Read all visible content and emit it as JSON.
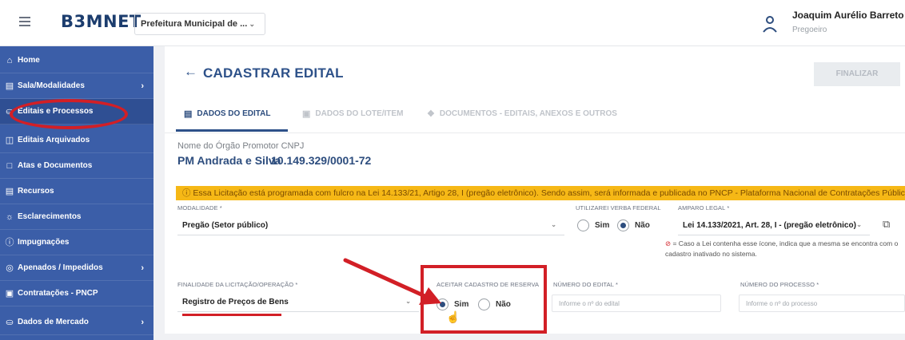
{
  "topbar": {
    "logo": "B3MNET",
    "org_select": "Prefeitura Municipal de ...",
    "user_name": "Joaquim Aurélio Barreto N.",
    "user_role": "Pregoeiro"
  },
  "sidebar": {
    "items": [
      {
        "label": "Home",
        "icon": "home-icon"
      },
      {
        "label": "Sala/Modalidades",
        "icon": "rooms-icon"
      },
      {
        "label": "Editais e Processos",
        "icon": "cart-icon"
      },
      {
        "label": "Editais Arquivados",
        "icon": "archive-icon"
      },
      {
        "label": "Atas e Documentos",
        "icon": "document-icon"
      },
      {
        "label": "Recursos",
        "icon": "resource-icon"
      },
      {
        "label": "Esclarecimentos",
        "icon": "sun-icon"
      },
      {
        "label": "Impugnações",
        "icon": "alert-circle-icon"
      },
      {
        "label": "Apenados / Impedidos",
        "icon": "blocked-icon"
      },
      {
        "label": "Contratações - PNCP",
        "icon": "contract-icon"
      },
      {
        "label": "Dados de Mercado",
        "icon": "cart-icon"
      }
    ]
  },
  "header": {
    "title": "CADASTRAR EDITAL",
    "finalize_label": "FINALIZAR",
    "tabs": [
      {
        "label": "DADOS DO EDITAL"
      },
      {
        "label": "DADOS DO LOTE/ITEM"
      },
      {
        "label": "DOCUMENTOS - EDITAIS, ANEXOS E OUTROS"
      }
    ]
  },
  "orgao": {
    "label": "Nome do Órgão Promotor CNPJ",
    "name": "PM Andrada e Silva",
    "cnpj": "10.149.329/0001-72"
  },
  "alert": {
    "text": "Essa Licitação está programada com fulcro na Lei 14.133/21, Artigo 28, I (pregão eletrônico). Sendo assim, será informada e publicada no PNCP - Plataforma Nacional de Contratações Públicas."
  },
  "form": {
    "modalidade_label": "MODALIDADE *",
    "modalidade_value": "Pregão (Setor público)",
    "verba_label": "UTILIZAREI VERBA FEDERAL",
    "verba_sim": "Sim",
    "verba_nao": "Não",
    "amparo_label": "AMPARO LEGAL *",
    "amparo_value": "Lei 14.133/2021, Art. 28, I - (pregão eletrônico)",
    "amparo_note": "= Caso a Lei contenha esse ícone, indica que a mesma se encontra com o cadastro inativado no sistema.",
    "finalidade_label": "FINALIDADE DA LICITAÇÃO/OPERAÇÃO *",
    "finalidade_value": "Registro de Preços de Bens",
    "reserva_label": "ACEITAR CADASTRO DE RESERVA",
    "reserva_sim": "Sim",
    "reserva_nao": "Não",
    "edital_label": "NÚMERO DO EDITAL *",
    "edital_placeholder": "Informe o nº do edital",
    "processo_label": "NÚMERO DO PROCESSO *",
    "processo_placeholder": "Informe o nº do processo"
  },
  "colors": {
    "sidebar": "#3b5ea8",
    "primary_text": "#2d4d7e",
    "alert": "#f6b816",
    "annotation": "#d21f26"
  }
}
